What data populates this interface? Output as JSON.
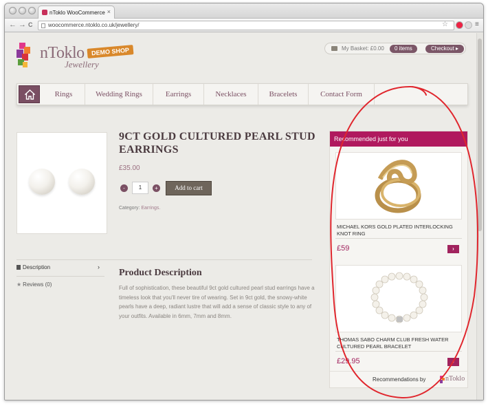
{
  "browser": {
    "tab_title": "nToklo WooCommerce",
    "tab_close": "×",
    "url": "woocommerce.ntoklo.co.uk/jewellery/",
    "back": "←",
    "forward": "→",
    "reload": "C",
    "star": "☆",
    "menu": "≡"
  },
  "header": {
    "logo_name": "nToklo",
    "logo_sub": "Jewellery",
    "demo_badge": "DEMO SHOP",
    "basket_label": "My Basket: £0.00",
    "basket_items": "0 items",
    "checkout": "Checkout ▸"
  },
  "nav": {
    "items": [
      "Rings",
      "Wedding Rings",
      "Earrings",
      "Necklaces",
      "Bracelets",
      "Contact Form"
    ]
  },
  "product": {
    "title": "9CT GOLD CULTURED PEARL STUD EARRINGS",
    "price": "£35.00",
    "qty_minus": "-",
    "qty_plus": "+",
    "qty_value": "1",
    "add_to_cart": "Add to cart",
    "category_label": "Category:",
    "category_value": "Earrings."
  },
  "tabs": {
    "description": "Description",
    "reviews": "Reviews (0)",
    "chevron": "›"
  },
  "description": {
    "title": "Product Description",
    "text": "Full of sophistication, these beautiful 9ct gold cultured pearl stud earrings have a timeless look that you'll never tire of wearing. Set in 9ct gold, the snowy-white pearls have a deep, radiant lustre that will add a sense of classic style to any of your outfits. Available in 6mm, 7mm and 8mm."
  },
  "recommendations": {
    "heading": "Recommended just for you",
    "items": [
      {
        "name": "MICHAEL KORS GOLD PLATED INTERLOCKING KNOT RING",
        "price": "£59",
        "go": "›"
      },
      {
        "name": "THOMAS SABO CHARM CLUB FRESH WATER CULTURED PEARL BRACELET",
        "price": "£29.95",
        "go": "›"
      }
    ],
    "footer": "Recommendations by",
    "footer_logo": "nToklo"
  },
  "colors": {
    "accent": "#b0195e",
    "brand_mauve": "#7a4f63",
    "annotation": "#e0262d"
  }
}
